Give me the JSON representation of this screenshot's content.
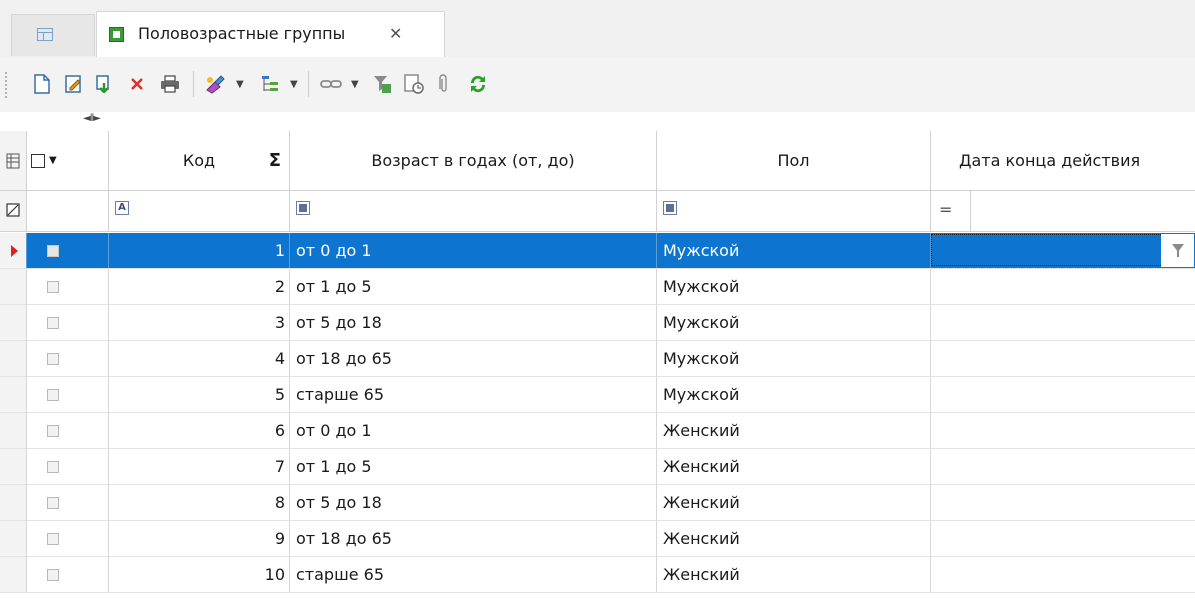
{
  "tabs": {
    "home_icon": "grid-icon",
    "active_label": "Половозрастные группы",
    "active_icon": "table-icon",
    "close_glyph": "✕"
  },
  "toolbar": {
    "icons": [
      "new-document-icon",
      "edit-icon",
      "copy-icon",
      "delete-icon",
      "print-icon",
      "brush-icon",
      "tree-icon",
      "link-icon",
      "filter-clear-icon",
      "history-icon",
      "attach-icon",
      "refresh-icon"
    ]
  },
  "grid": {
    "columns": {
      "kod": "Код",
      "sum_glyph": "Σ",
      "age": "Возраст в годах (от, до)",
      "sex": "Пол",
      "end_date": "Дата конца действия"
    },
    "filter_row": {
      "kod_icon": "A",
      "eq_glyph": "="
    },
    "rows": [
      {
        "code": "1",
        "age": "от 0 до 1",
        "sex": "Мужской",
        "selected": true
      },
      {
        "code": "2",
        "age": "от 1 до 5",
        "sex": "Мужской"
      },
      {
        "code": "3",
        "age": "от 5 до 18",
        "sex": "Мужской"
      },
      {
        "code": "4",
        "age": "от 18 до 65",
        "sex": "Мужской"
      },
      {
        "code": "5",
        "age": "старше 65",
        "sex": "Мужской"
      },
      {
        "code": "6",
        "age": "от 0 до 1",
        "sex": "Женский"
      },
      {
        "code": "7",
        "age": "от 1 до 5",
        "sex": "Женский"
      },
      {
        "code": "8",
        "age": "от 5 до 18",
        "sex": "Женский"
      },
      {
        "code": "9",
        "age": "от 18 до 65",
        "sex": "Женский"
      },
      {
        "code": "10",
        "age": "старше 65",
        "sex": "Женский"
      }
    ],
    "colors": {
      "selection": "#0d75d0",
      "indicator_arrow": "#e02020"
    }
  }
}
